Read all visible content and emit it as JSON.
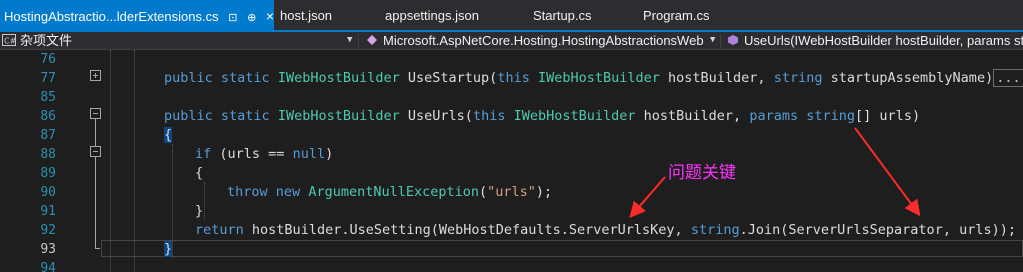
{
  "tabs": [
    {
      "label": "HostingAbstractio...lderExtensions.cs",
      "active": true
    },
    {
      "label": "host.json"
    },
    {
      "label": "appsettings.json"
    },
    {
      "label": "Startup.cs"
    },
    {
      "label": "Program.cs"
    }
  ],
  "tab_icons": {
    "pin": "⊡",
    "pin2": "⊕",
    "close": "×"
  },
  "navbar": {
    "project": "杂项文件",
    "type": "Microsoft.AspNetCore.Hosting.HostingAbstractionsWeb",
    "member": "UseUrls(IWebHostBuilder hostBuilder, params st"
  },
  "line_numbers": [
    "76",
    "77",
    "85",
    "86",
    "87",
    "88",
    "89",
    "90",
    "91",
    "92",
    "93",
    "94"
  ],
  "code": {
    "l77": {
      "kw1": "public",
      "kw2": "static",
      "ty1": "IWebHostBuilder",
      "name": "UseStartup(",
      "kw3": "this",
      "ty2": "IWebHostBuilder",
      "p1": "hostBuilder,",
      "kw4": "string",
      "p2": "startupAssemblyName)",
      "collapsed": "..."
    },
    "l86": {
      "kw1": "public",
      "kw2": "static",
      "ty1": "IWebHostBuilder",
      "name": "UseUrls(",
      "kw3": "this",
      "ty2": "IWebHostBuilder",
      "p1": "hostBuilder,",
      "kw4": "params",
      "kw5": "string",
      "p2": "[] urls)"
    },
    "l87": "{",
    "l88": {
      "kw1": "if",
      "p1": "(urls ==",
      "kw2": "null",
      "p2": ")"
    },
    "l89": "{",
    "l90": {
      "kw1": "throw",
      "kw2": "new",
      "ty1": "ArgumentNullException",
      "p1": "(",
      "str": "\"urls\"",
      "p2": ");"
    },
    "l91": "}",
    "l92": {
      "kw1": "return",
      "p1": "hostBuilder.UseSetting(WebHostDefaults.ServerUrlsKey,",
      "kw2": "string",
      "p2": ".Join(ServerUrlsSeparator, urls));"
    },
    "l93": "}"
  },
  "annotation": {
    "text": "问题关键",
    "color": "#ff33ff"
  }
}
